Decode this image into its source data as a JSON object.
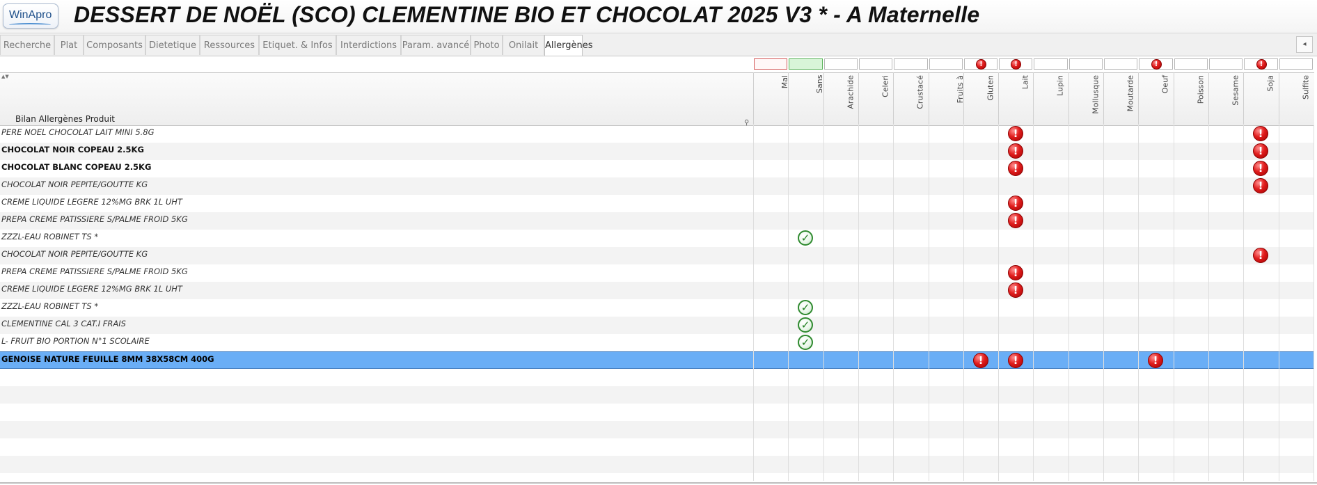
{
  "app": {
    "logo_text": "WinApro",
    "title": "DESSERT DE NOËL (SCO) CLEMENTINE BIO ET CHOCOLAT 2025 V3 * - A Maternelle"
  },
  "tabs": [
    {
      "label": "Recherche"
    },
    {
      "label": "Plat"
    },
    {
      "label": "Composants"
    },
    {
      "label": "Dietetique"
    },
    {
      "label": "Ressources"
    },
    {
      "label": "Etiquet. & Infos"
    },
    {
      "label": "Interdictions"
    },
    {
      "label": "Param. avancé"
    },
    {
      "label": "Photo"
    },
    {
      "label": "Onilait"
    },
    {
      "label": "Allergènes"
    }
  ],
  "active_tab": "Allergènes",
  "grid": {
    "name_header": "Bilan Allergènes Produit",
    "columns": [
      {
        "label": "Mal\nrenseigné",
        "summary": "red-empty"
      },
      {
        "label": "Sans\nAllergenes",
        "summary": "green-empty"
      },
      {
        "label": "Arachide",
        "summary": "empty"
      },
      {
        "label": "Celeri",
        "summary": "empty"
      },
      {
        "label": "Crustacé",
        "summary": "empty"
      },
      {
        "label": "Fruits à\ncoque",
        "summary": "empty"
      },
      {
        "label": "Gluten",
        "summary": "warning"
      },
      {
        "label": "Lait",
        "summary": "warning"
      },
      {
        "label": "Lupin",
        "summary": "empty"
      },
      {
        "label": "Mollusque",
        "summary": "empty"
      },
      {
        "label": "Moutarde",
        "summary": "empty"
      },
      {
        "label": "Oeuf",
        "summary": "warning"
      },
      {
        "label": "Poisson",
        "summary": "empty"
      },
      {
        "label": "Sesame",
        "summary": "empty"
      },
      {
        "label": "Soja",
        "summary": "warning"
      },
      {
        "label": "Sulfite",
        "summary": "empty"
      }
    ],
    "rows": [
      {
        "name": "PERE NOEL CHOCOLAT LAIT MINI 5.8G",
        "style": "italic",
        "warn": [
          "Lait",
          "Soja"
        ],
        "ok": []
      },
      {
        "name": "CHOCOLAT NOIR COPEAU 2.5KG",
        "style": "bold",
        "warn": [
          "Lait",
          "Soja"
        ],
        "ok": []
      },
      {
        "name": "CHOCOLAT BLANC COPEAU 2.5KG",
        "style": "bold",
        "warn": [
          "Lait",
          "Soja"
        ],
        "ok": []
      },
      {
        "name": "CHOCOLAT NOIR PEPITE/GOUTTE KG",
        "style": "italic",
        "warn": [
          "Soja"
        ],
        "ok": []
      },
      {
        "name": "CREME LIQUIDE LEGERE 12%MG BRK 1L UHT",
        "style": "italic",
        "warn": [
          "Lait"
        ],
        "ok": []
      },
      {
        "name": "PREPA CREME PATISSIERE S/PALME FROID 5KG",
        "style": "italic",
        "warn": [
          "Lait"
        ],
        "ok": []
      },
      {
        "name": "ZZZL-EAU  ROBINET TS *",
        "style": "italic",
        "warn": [],
        "ok": [
          "Sans Allergenes"
        ]
      },
      {
        "name": "CHOCOLAT NOIR PEPITE/GOUTTE KG",
        "style": "italic",
        "warn": [
          "Soja"
        ],
        "ok": []
      },
      {
        "name": "PREPA CREME PATISSIERE S/PALME FROID 5KG",
        "style": "italic",
        "warn": [
          "Lait"
        ],
        "ok": []
      },
      {
        "name": "CREME LIQUIDE LEGERE 12%MG BRK 1L UHT",
        "style": "italic",
        "warn": [
          "Lait"
        ],
        "ok": []
      },
      {
        "name": "ZZZL-EAU  ROBINET TS *",
        "style": "italic",
        "warn": [],
        "ok": [
          "Sans Allergenes"
        ]
      },
      {
        "name": "CLEMENTINE CAL 3 CAT.I FRAIS",
        "style": "italic",
        "warn": [],
        "ok": [
          "Sans Allergenes"
        ]
      },
      {
        "name": "L- FRUIT BIO PORTION N°1 SCOLAIRE",
        "style": "italic",
        "warn": [],
        "ok": [
          "Sans Allergenes"
        ]
      },
      {
        "name": "GENOISE NATURE FEUILLE 8MM 38X58CM 400G",
        "style": "bold",
        "selected": true,
        "warn": [
          "Gluten",
          "Lait",
          "Oeuf"
        ],
        "ok": []
      }
    ],
    "empty_rows": 6
  },
  "colors": {
    "selected_row": "#6aaef6",
    "warning": "#e11d1d",
    "ok": "#2f8a2f"
  }
}
